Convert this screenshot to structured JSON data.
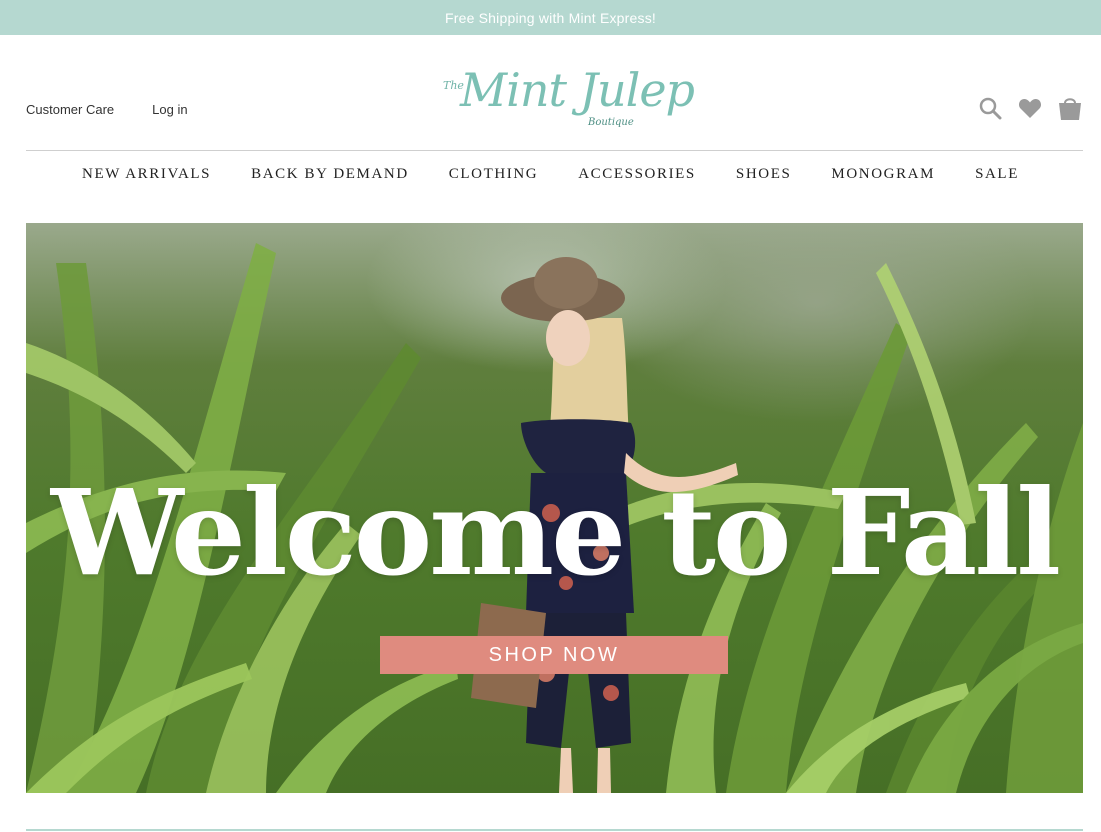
{
  "promo": {
    "text": "Free Shipping with Mint Express!"
  },
  "header": {
    "links": [
      "Customer Care",
      "Log in"
    ],
    "logo": {
      "prefix": "The",
      "name": "Mint Julep",
      "suffix": "Boutique"
    },
    "icons": [
      "search-icon",
      "heart-icon",
      "shopping-bag-icon"
    ]
  },
  "nav": {
    "items": [
      "NEW ARRIVALS",
      "BACK BY DEMAND",
      "CLOTHING",
      "ACCESSORIES",
      "SHOES",
      "MONOGRAM",
      "SALE"
    ]
  },
  "hero": {
    "title": "Welcome to Fall",
    "button": "SHOP NOW"
  },
  "colors": {
    "promo_bg": "#b5d8d0",
    "logo": "#7cc0b4",
    "button": "#df8b7f"
  }
}
